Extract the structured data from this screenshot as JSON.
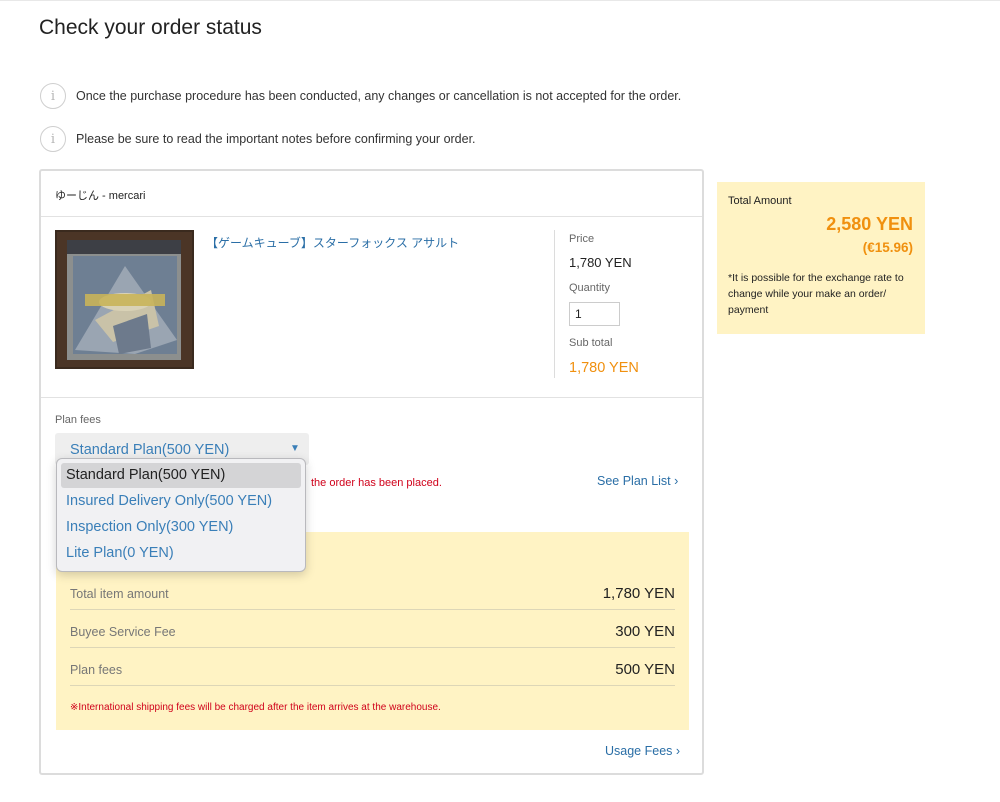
{
  "page": {
    "title": "Check your order status"
  },
  "notices": [
    "Once the purchase procedure has been conducted, any changes or cancellation is not accepted for the order.",
    "Please be sure to read the important notes before confirming your order."
  ],
  "order": {
    "seller": "ゆーじん - mercari",
    "product_title": "【ゲームキューブ】スターフォックス アサルト",
    "price_label": "Price",
    "price": "1,780 YEN",
    "quantity_label": "Quantity",
    "quantity": "1",
    "subtotal_label": "Sub total",
    "subtotal": "1,780 YEN",
    "plan_label": "Plan fees",
    "plan_selected": "Standard Plan(500 YEN)",
    "plan_warning": "the order has been placed.",
    "see_plan_list": "See Plan List ›",
    "plan_options": [
      "Standard Plan(500 YEN)",
      "Insured Delivery Only(500 YEN)",
      "Inspection Only(300 YEN)",
      "Lite Plan(0 YEN)"
    ],
    "summary": {
      "rows": [
        {
          "label": "Total item amount",
          "value": "1,780 YEN"
        },
        {
          "label": "Buyee Service Fee",
          "value": "300 YEN"
        },
        {
          "label": "Plan fees",
          "value": "500 YEN"
        }
      ],
      "note": "※International shipping fees will be charged after the item arrives at the warehouse."
    },
    "usage_fees": "Usage Fees ›"
  },
  "total": {
    "label": "Total Amount",
    "yen": "2,580 YEN",
    "eur": "(€15.96)",
    "note": "*It is possible for the exchange rate to change while your make an order/ payment"
  },
  "colors": {
    "accent_orange": "#f0900f",
    "link_blue": "#2a6ea6",
    "summary_bg": "#fff3c4",
    "warning_red": "#d0021b"
  }
}
